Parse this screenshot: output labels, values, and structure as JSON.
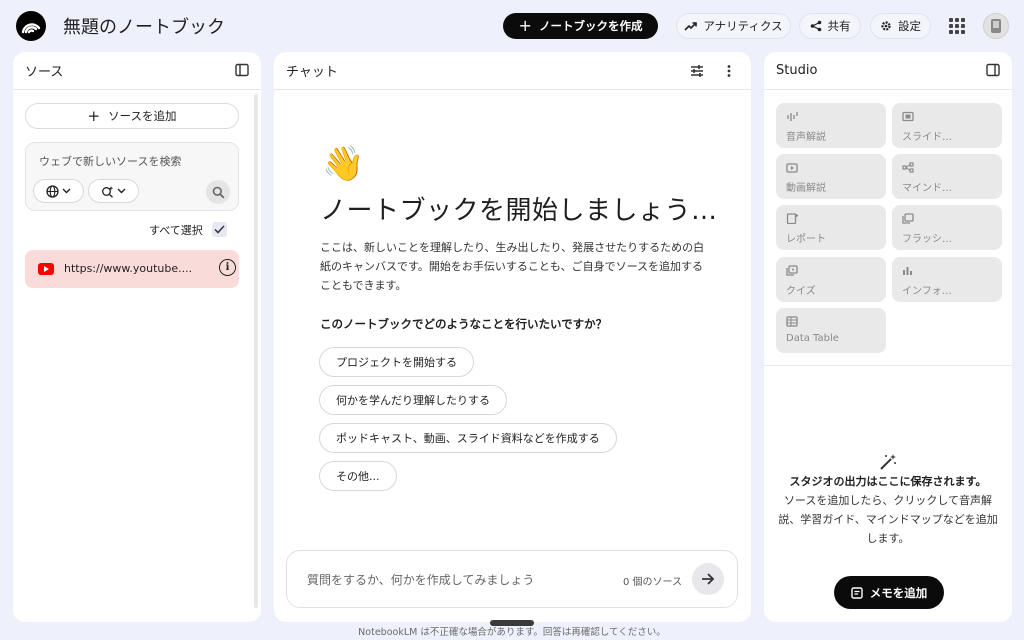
{
  "header": {
    "title": "無題のノートブック",
    "create_label": "ノートブックを作成",
    "analytics_label": "アナリティクス",
    "share_label": "共有",
    "settings_label": "設定"
  },
  "sources": {
    "title": "ソース",
    "add_label": "ソースを追加",
    "search_placeholder": "ウェブで新しいソースを検索",
    "select_all_label": "すべて選択",
    "items": [
      {
        "url": "https://www.youtube....",
        "type": "youtube-icon"
      }
    ]
  },
  "chat": {
    "title": "チャット",
    "emoji": "👋",
    "heading": "ノートブックを開始しましょう…",
    "description": "ここは、新しいことを理解したり、生み出したり、発展させたりするための白紙のキャンバスです。開始をお手伝いすることも、ご自身でソースを追加することもできます。",
    "question": "このノートブックでどのようなことを行いたいですか？",
    "suggestions": [
      "プロジェクトを開始する",
      "何かを学んだり理解したりする",
      "ポッドキャスト、動画、スライド資料などを作成する",
      "その他..."
    ],
    "input_placeholder": "質問をするか、何かを作成してみましょう",
    "source_count": "0 個のソース"
  },
  "studio": {
    "title": "Studio",
    "tiles": [
      {
        "label": "音声解説",
        "icon": "audio-waveform-icon"
      },
      {
        "label": "スライド…",
        "icon": "slides-icon"
      },
      {
        "label": "動画解説",
        "icon": "video-icon"
      },
      {
        "label": "マインド…",
        "icon": "mindmap-icon"
      },
      {
        "label": "レポート",
        "icon": "report-icon"
      },
      {
        "label": "フラッシ…",
        "icon": "flashcards-icon"
      },
      {
        "label": "クイズ",
        "icon": "quiz-icon"
      },
      {
        "label": "インフォ…",
        "icon": "infographic-icon"
      },
      {
        "label": "Data Table",
        "icon": "table-icon"
      }
    ],
    "empty_title": "スタジオの出力はここに保存されます。",
    "empty_desc": "ソースを追加したら、クリックして音声解説、学習ガイド、マインドマップなどを追加します。",
    "memo_label": "メモを追加"
  },
  "footer": {
    "note": "NotebookLM は不正確な場合があります。回答は再確認してください。"
  }
}
